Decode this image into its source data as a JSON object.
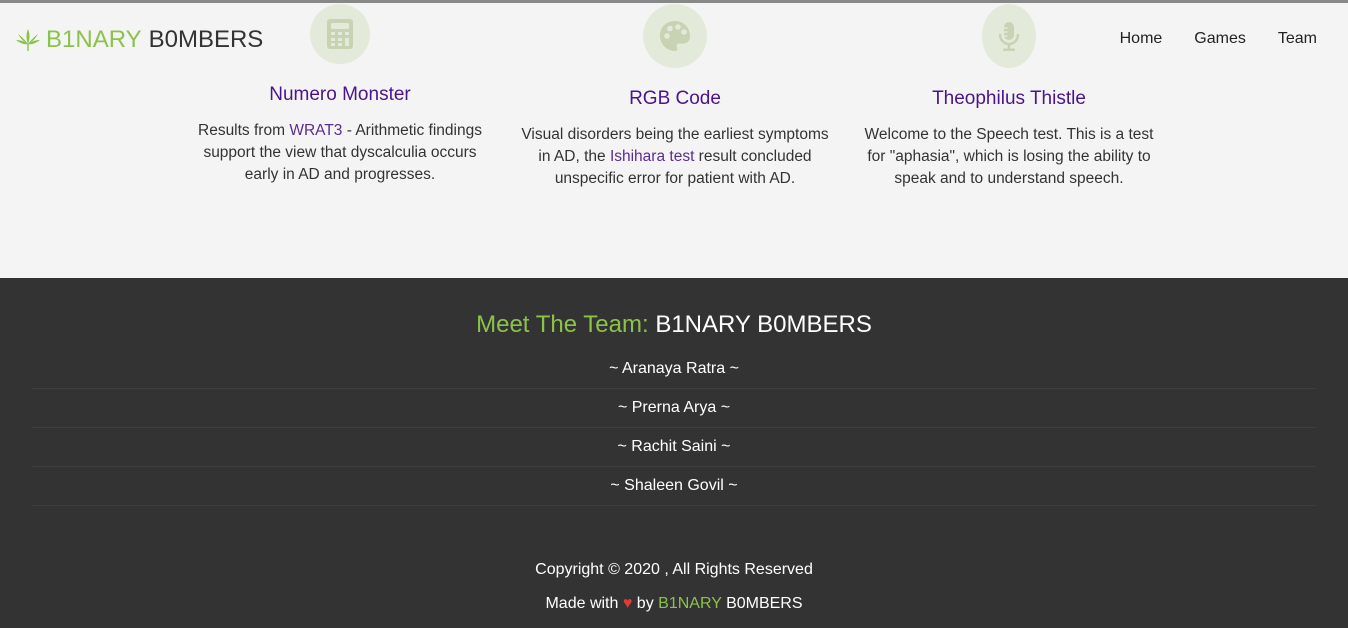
{
  "brand": {
    "part1": "B1NARY",
    "part2": "B0MBERS"
  },
  "nav": {
    "home": "Home",
    "games": "Games",
    "team": "Team"
  },
  "cards": [
    {
      "icon": "calculator-icon",
      "title": "Numero Monster",
      "text_before": "Results from ",
      "link": "WRAT3",
      "text_after": " - Arithmetic findings support the view that dyscalculia occurs early in AD and progresses."
    },
    {
      "icon": "palette-icon",
      "title": "RGB Code",
      "text_before": "Visual disorders being the earliest symptoms in AD, the ",
      "link": "Ishihara test",
      "text_after": " result concluded unspecific error for patient with AD."
    },
    {
      "icon": "microphone-icon",
      "title": "Theophilus Thistle",
      "text": "Welcome to the Speech test. This is a test for \"aphasia\", which is losing the ability to speak and to understand speech."
    }
  ],
  "team": {
    "title_part1": "Meet The Team:",
    "title_part2": "B1NARY B0MBERS",
    "members": [
      "~ Aranaya Ratra ~",
      "~ Prerna Arya ~",
      "~ Rachit Saini ~",
      "~ Shaleen Govil ~"
    ]
  },
  "footer": {
    "copyright": "Copyright © 2020 ,  All Rights Reserved",
    "made_with": "Made with",
    "heart": "♥",
    "by": "by",
    "brand1": "B1NARY",
    "brand2": "B0MBERS"
  },
  "colors": {
    "accent_green": "#8bc34a",
    "title_purple": "#4a148c",
    "dark_bg": "#333333"
  }
}
